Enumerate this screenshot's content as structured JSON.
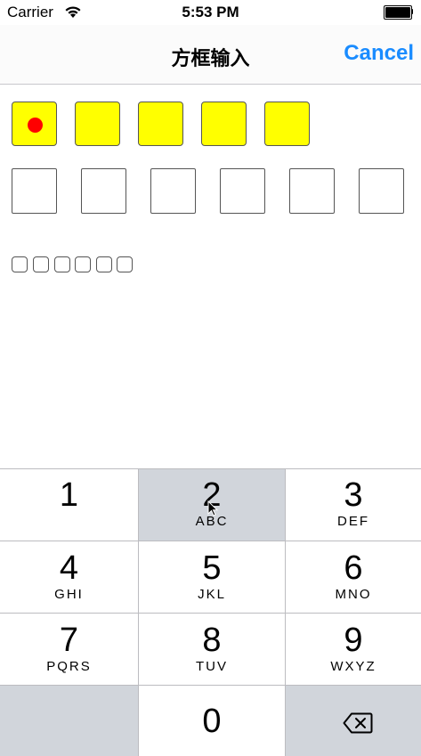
{
  "status_bar": {
    "carrier": "Carrier",
    "time": "5:53 PM",
    "wifi_icon": "wifi-icon",
    "battery_icon": "battery-icon"
  },
  "nav": {
    "title": "方框输入",
    "cancel_label": "Cancel",
    "cancel_color": "#1a8cff"
  },
  "inputs": {
    "row1": {
      "box_count": 5,
      "fill_color": "#ffff00",
      "filled_dots": 1,
      "dot_color": "#ff0000"
    },
    "row2": {
      "box_count": 6
    },
    "row3": {
      "box_count": 6
    }
  },
  "keypad": {
    "keys": [
      {
        "digit": "1",
        "letters": ""
      },
      {
        "digit": "2",
        "letters": "ABC"
      },
      {
        "digit": "3",
        "letters": "DEF"
      },
      {
        "digit": "4",
        "letters": "GHI"
      },
      {
        "digit": "5",
        "letters": "JKL"
      },
      {
        "digit": "6",
        "letters": "MNO"
      },
      {
        "digit": "7",
        "letters": "PQRS"
      },
      {
        "digit": "8",
        "letters": "TUV"
      },
      {
        "digit": "9",
        "letters": "WXYZ"
      },
      {
        "digit": "0",
        "letters": ""
      }
    ],
    "pressed_key": "2",
    "delete_icon": "backspace-icon"
  }
}
